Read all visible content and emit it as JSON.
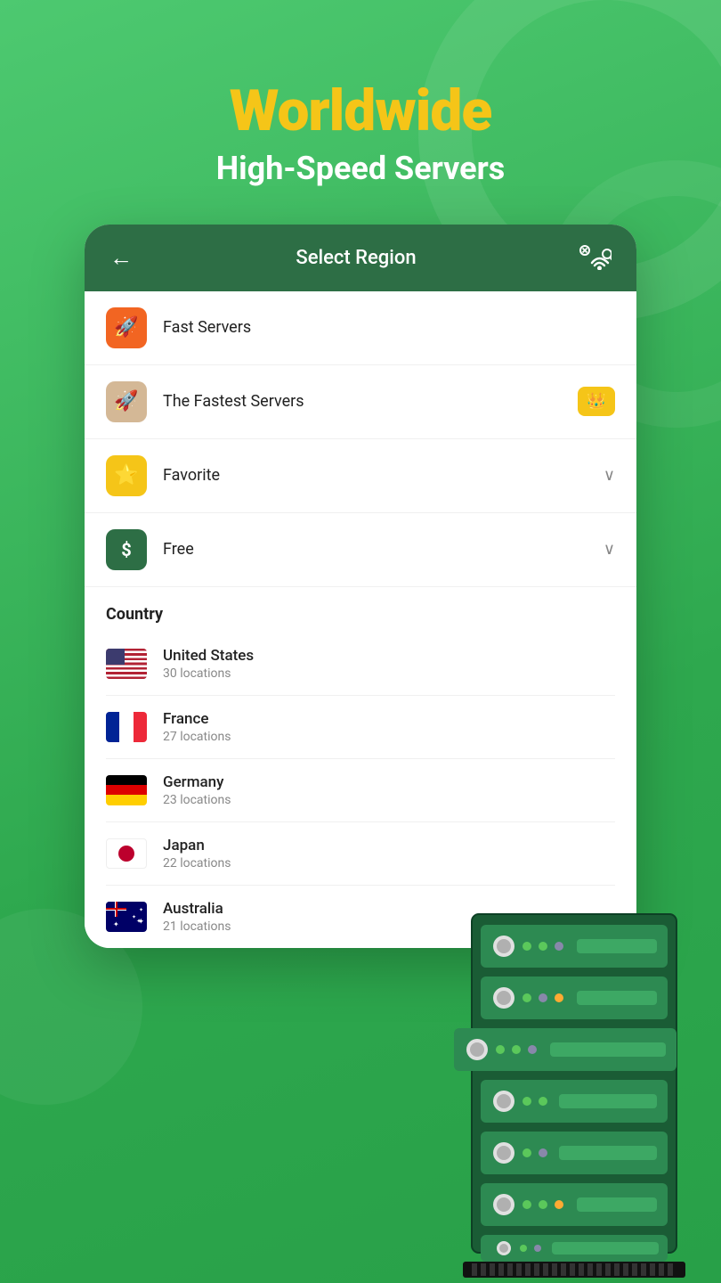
{
  "header": {
    "title": "Worldwide",
    "subtitle": "High-Speed Servers"
  },
  "topbar": {
    "title": "Select Region",
    "back_label": "←"
  },
  "menu": {
    "items": [
      {
        "id": "fast-servers",
        "label": "Fast Servers",
        "icon": "🚀",
        "icon_class": "icon-orange",
        "right": ""
      },
      {
        "id": "fastest-servers",
        "label": "The Fastest Servers",
        "icon": "🚀",
        "icon_class": "icon-tan",
        "right": "crown"
      },
      {
        "id": "favorite",
        "label": "Favorite",
        "icon": "⭐",
        "icon_class": "icon-yellow",
        "right": "chevron"
      },
      {
        "id": "free",
        "label": "Free",
        "icon": "$",
        "icon_class": "icon-green",
        "right": "chevron"
      }
    ]
  },
  "country_section": {
    "header": "Country",
    "countries": [
      {
        "id": "us",
        "name": "United States",
        "locations": "30 locations",
        "flag": "us"
      },
      {
        "id": "fr",
        "name": "France",
        "locations": "27 locations",
        "flag": "fr"
      },
      {
        "id": "de",
        "name": "Germany",
        "locations": "23 locations",
        "flag": "de"
      },
      {
        "id": "jp",
        "name": "Japan",
        "locations": "22 locations",
        "flag": "jp"
      },
      {
        "id": "au",
        "name": "Australia",
        "locations": "21 locations",
        "flag": "au"
      }
    ]
  }
}
